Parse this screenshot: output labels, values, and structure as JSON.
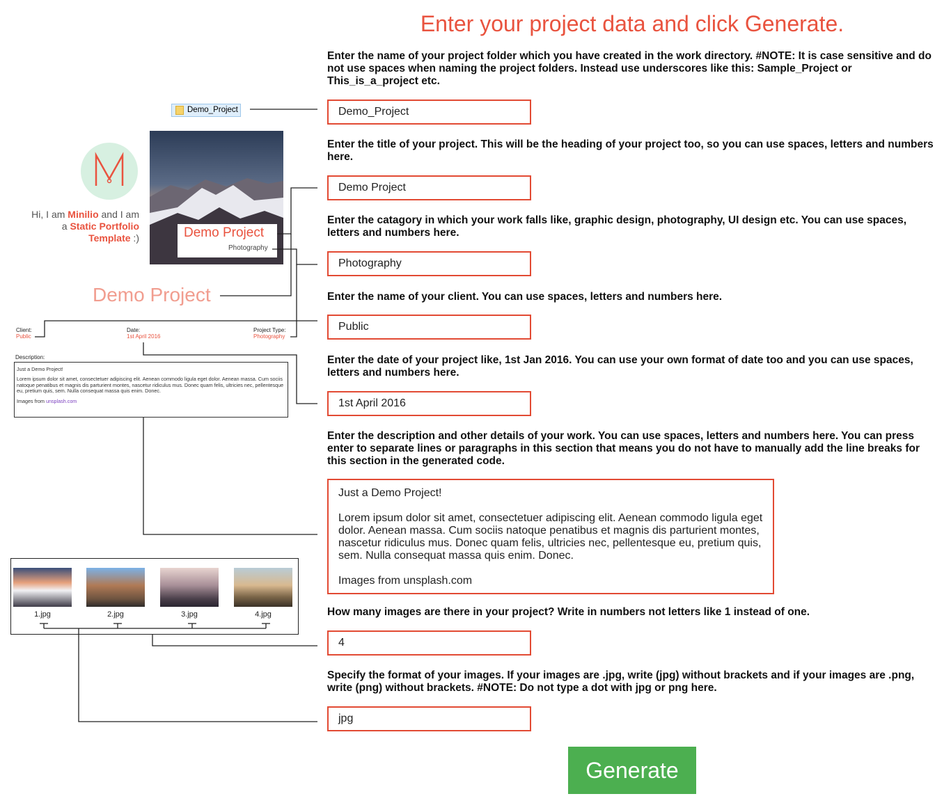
{
  "headline": "Enter your project data and click Generate.",
  "instructions": {
    "folder": "Enter the name of your project folder which you have created in the work directory. #NOTE: It is case sensitive and do not use spaces when naming the project folders. Instead use underscores like this: Sample_Project or This_is_a_project etc.",
    "title": "Enter the title of your project. This will be the heading of your project too, so you can use spaces, letters and numbers here.",
    "category": "Enter the catagory in which your work falls like, graphic design, photography, UI design etc. You can use spaces, letters and numbers here.",
    "client": "Enter the name of your client. You can use spaces, letters and numbers here.",
    "date": "Enter the date of your project like, 1st Jan 2016. You can use your own format of date too and you can use spaces, letters and numbers here.",
    "description": "Enter the description and other details of your work. You can use spaces, letters and numbers here. You can press enter to separate lines or paragraphs in this section that means you do not have to manually add the line breaks for this section in the generated code.",
    "image_count": "How many images are there in your project? Write in numbers not letters like 1 instead of one.",
    "image_format": "Specify the format of your images. If your images are .jpg, write (jpg) without brackets and if your images are .png, write (png) without brackets. #NOTE: Do not type a dot with jpg or png here."
  },
  "fields": {
    "folder": "Demo_Project",
    "title": "Demo Project",
    "category": "Photography",
    "client": "Public",
    "date": "1st April 2016",
    "description": "Just a Demo Project!\n\nLorem ipsum dolor sit amet, consectetuer adipiscing elit. Aenean commodo ligula eget dolor. Aenean massa. Cum sociis natoque penatibus et magnis dis parturient montes, nascetur ridiculus mus. Donec quam felis, ultricies nec, pellentesque eu, pretium quis, sem. Nulla consequat massa quis enim. Donec.\n\nImages from unsplash.com",
    "image_count": "4",
    "image_format": "jpg"
  },
  "generate_label": "Generate",
  "preview": {
    "folder_chip": "Demo_Project",
    "intro_part1": "Hi, I am ",
    "intro_name": "Minilio",
    "intro_part2": " and I am a ",
    "intro_highlight": "Static Portfolio Template",
    "intro_part3": " :)",
    "hero_title": "Demo Project",
    "hero_sub": "Photography",
    "big_title": "Demo Project",
    "client_label": "Client:",
    "client_val": "Public",
    "date_label": "Date:",
    "date_val": "1st April 2016",
    "type_label": "Project Type:",
    "type_val": "Photography",
    "desc_label": "Description:",
    "desc_line1": "Just a Demo Project!",
    "desc_body": "Lorem ipsum dolor sit amet, consectetuer adipiscing elit. Aenean commodo ligula eget dolor. Aenean massa. Cum sociis natoque penatibus et magnis dis parturient montes, nascetur ridiculus mus. Donec quam felis, ultricies nec, pellentesque eu, pretium quis, sem. Nulla consequat massa quis enim. Donec.",
    "desc_credit_prefix": "Images from ",
    "desc_credit_link": "unsplash.com",
    "thumbs": [
      "1.jpg",
      "2.jpg",
      "3.jpg",
      "4.jpg"
    ]
  },
  "colors": {
    "accent": "#e9533f",
    "generate": "#4caf50"
  }
}
